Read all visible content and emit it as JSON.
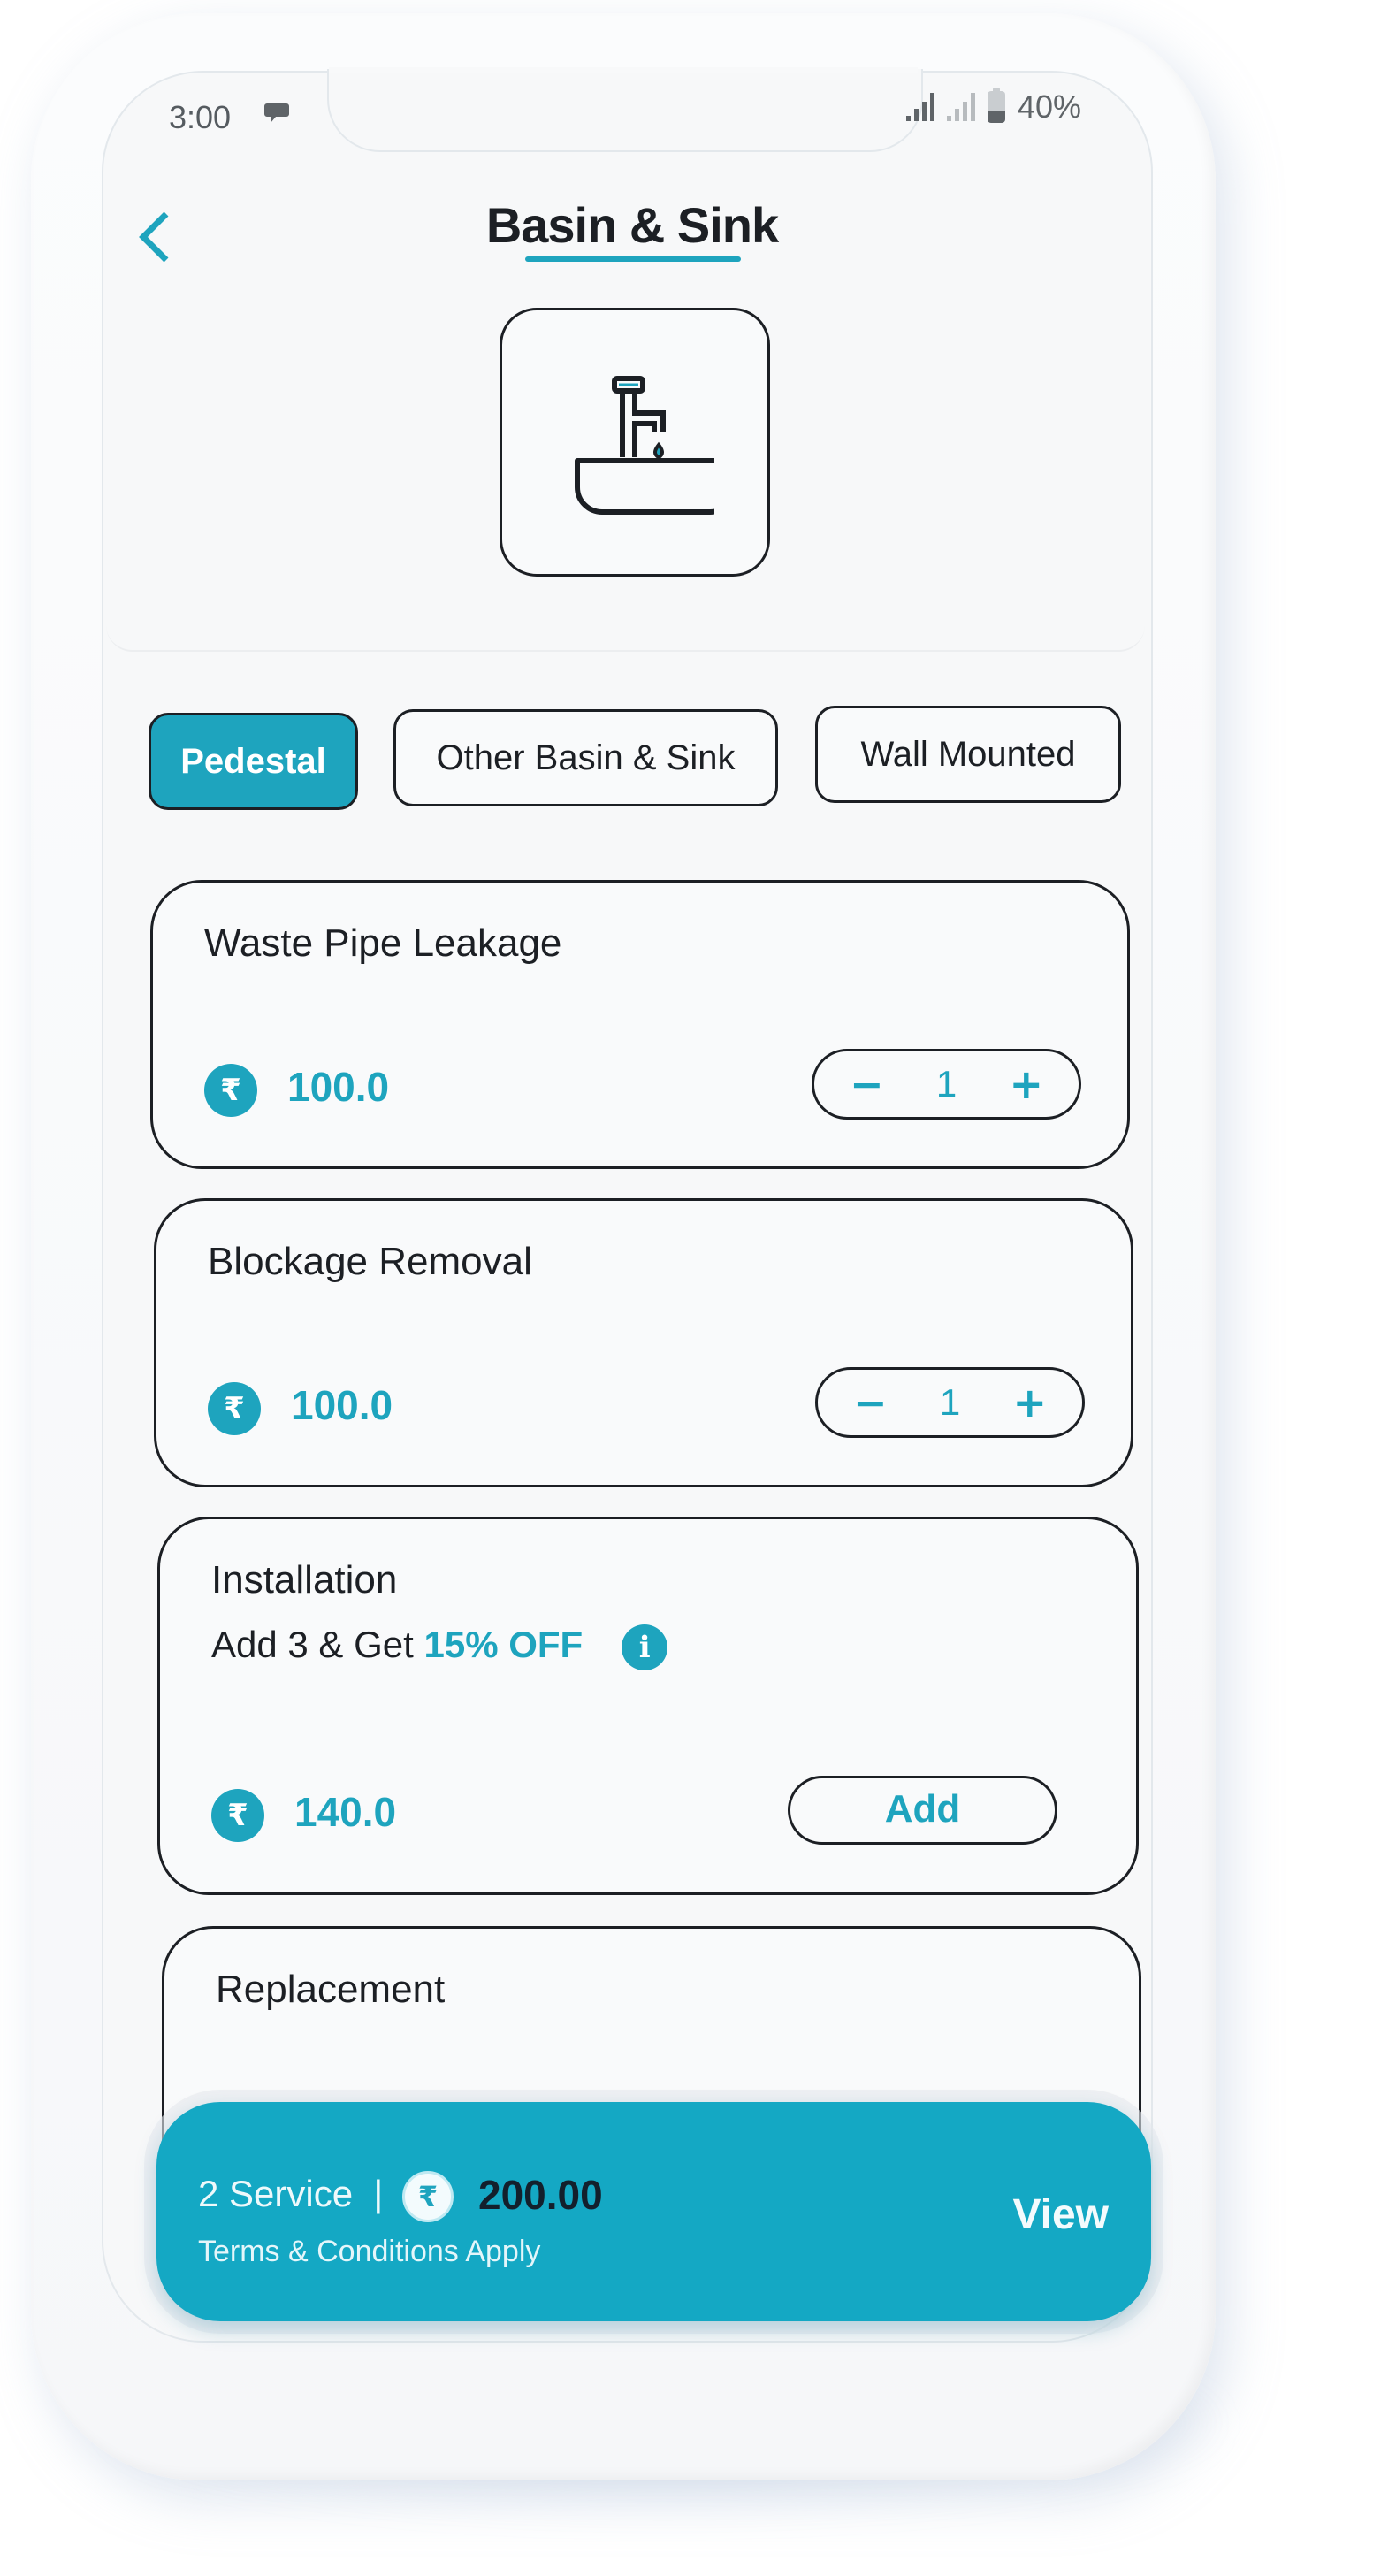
{
  "status_bar": {
    "time": "3:00",
    "notification_icon": "message-icon",
    "signal_icons": [
      "signal-strong-icon",
      "signal-weak-icon"
    ],
    "battery_icon": "battery-icon",
    "battery_level_percent": 40,
    "battery_text": "40%"
  },
  "header": {
    "back_icon": "chevron-left-icon",
    "title": "Basin & Sink",
    "hero_icon": "wash-basin-icon"
  },
  "tabs": [
    {
      "label": "Pedestal",
      "active": true
    },
    {
      "label": "Other Basin & Sink",
      "active": false
    },
    {
      "label": "Wall Mounted",
      "active": false
    }
  ],
  "services": [
    {
      "title": "Waste Pipe Leakage",
      "currency_icon": "rupee-icon",
      "price": "100.0",
      "quantity": "1",
      "decrement": "−",
      "increment": "+"
    },
    {
      "title": "Blockage Removal",
      "currency_icon": "rupee-icon",
      "price": "100.0",
      "quantity": "1",
      "decrement": "−",
      "increment": "+"
    },
    {
      "title": "Installation",
      "offer_prefix": "Add 3 & Get ",
      "offer_highlight": "15% OFF",
      "offer_info_icon": "info-icon",
      "currency_icon": "rupee-icon",
      "price": "140.0",
      "action_label": "Add"
    },
    {
      "title": "Replacement"
    }
  ],
  "cart": {
    "count_label": "2 Service",
    "separator": "|",
    "currency_symbol": "₹",
    "total": "200.00",
    "terms": "Terms & Conditions Apply",
    "view_label": "View"
  },
  "colors": {
    "accent": "#1ea4be",
    "cart_bar": "#14a8c4",
    "text_dark": "#1c1f24",
    "screen_bg": "#f7f8f9"
  },
  "symbols": {
    "rupee": "₹",
    "info": "i"
  }
}
